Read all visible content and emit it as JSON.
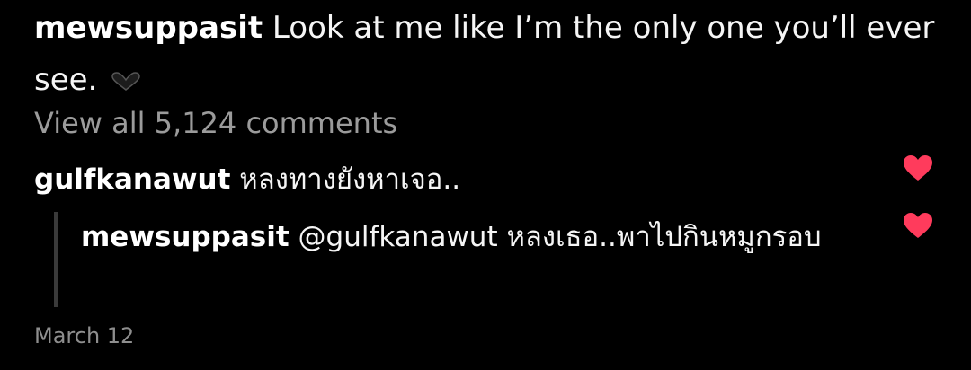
{
  "post": {
    "author": "mewsuppasit",
    "caption": "Look at me like I’m the only one you’ll ever see.",
    "view_all_comments": "View all 5,124 comments",
    "date": "March 12"
  },
  "comments": [
    {
      "author": "gulfkanawut",
      "text": "หลงทางยังหาเจอ.."
    }
  ],
  "replies": [
    {
      "author": "mewsuppasit",
      "mention": "@gulfkanawut",
      "text": "หลงเธอ..พาไปกินหมูกรอบ"
    }
  ],
  "colors": {
    "background": "#000000",
    "like_heart": "#ff3b5c",
    "secondary_text": "#9b9b9b",
    "reply_bar": "#3a3a3a"
  },
  "icons": {
    "caption_emoji": "black-heart-icon",
    "like": "heart-icon"
  }
}
